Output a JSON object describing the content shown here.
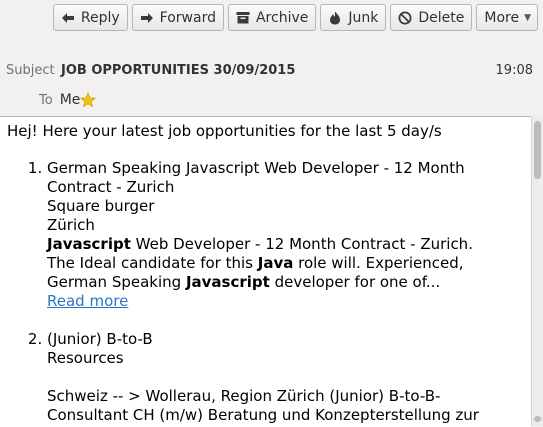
{
  "toolbar": {
    "buttons": [
      {
        "id": "reply",
        "label": "Reply",
        "icon": "reply-icon"
      },
      {
        "id": "forward",
        "label": "Forward",
        "icon": "forward-icon"
      },
      {
        "id": "archive",
        "label": "Archive",
        "icon": "archive-icon"
      },
      {
        "id": "junk",
        "label": "Junk",
        "icon": "junk-icon"
      },
      {
        "id": "delete",
        "label": "Delete",
        "icon": "delete-icon"
      },
      {
        "id": "more",
        "label": "More",
        "icon": "chevron-down-icon"
      }
    ]
  },
  "header": {
    "subject_label": "Subject",
    "subject": "JOB OPPORTUNITIES 30/09/2015",
    "time": "19:08",
    "to_label": "To",
    "to_value": "Me",
    "star_color": "#f5c211"
  },
  "message": {
    "intro": "Hej! Here your latest job opportunities for the last 5 day/s",
    "items": [
      {
        "title_line1": "German Speaking Javascript Web Developer - 12 Month",
        "title_line2": "Contract - Zurich",
        "company": "Square burger",
        "location": "Zürich",
        "desc1_b": "Javascript",
        "desc1_rest": " Web Developer - 12 Month Contract - Zurich.",
        "desc2_pre": "The Ideal candidate for this ",
        "desc2_b": "Java",
        "desc2_post": " role will. Experienced,",
        "desc3_pre": "German Speaking ",
        "desc3_b": "Javascript",
        "desc3_post": " developer for one of...",
        "read_more": "Read more"
      },
      {
        "title_line1": "(Junior) B-to-B",
        "company": "Resources",
        "desc1": "Schweiz -- > Wollerau, Region Zürich (Junior) B-to-B-",
        "desc2": "Consultant CH (m/w) Beratung und Konzepterstellung zur"
      }
    ]
  },
  "colors": {
    "link": "#2a76c6",
    "header_bg": "#f2f1f0",
    "body_bg": "#ffffff"
  }
}
